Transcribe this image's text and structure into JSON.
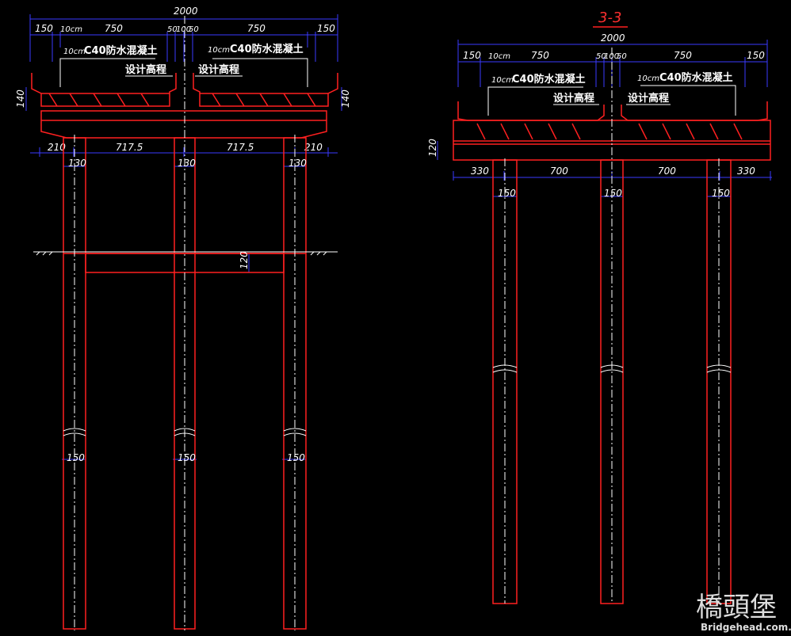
{
  "left_view": {
    "dims_top": {
      "total": "2000",
      "seg": [
        "150",
        "10cm",
        "750",
        "50",
        "100",
        "50",
        "750",
        "150"
      ]
    },
    "notes": {
      "concrete_left": "C40防水混凝土",
      "concrete_left_prefix": "10cm",
      "concrete_right": "C40防水混凝土",
      "concrete_right_prefix": "10cm",
      "elev_left": "设计高程",
      "elev_right": "设计高程"
    },
    "dims_side": {
      "left": "140",
      "right": "140"
    },
    "dims_cap": [
      "210",
      "717.5",
      "717.5",
      "210"
    ],
    "dims_pile_top": [
      "130",
      "130",
      "130"
    ],
    "dims_tie": "120",
    "dims_pile_bottom": [
      "150",
      "150",
      "150"
    ]
  },
  "right_view": {
    "title": "3-3",
    "dims_top": {
      "total": "2000",
      "seg": [
        "150",
        "10cm",
        "750",
        "50",
        "100",
        "50",
        "750",
        "150"
      ]
    },
    "notes": {
      "concrete_left": "C40防水混凝土",
      "concrete_left_prefix": "10cm",
      "concrete_right": "C40防水混凝土",
      "concrete_right_prefix": "10cm",
      "elev_left": "设计高程",
      "elev_right": "设计高程"
    },
    "dims_side": "120",
    "dims_cap": [
      "330",
      "700",
      "700",
      "330"
    ],
    "dims_pile": [
      "150",
      "150",
      "150"
    ]
  },
  "watermark": {
    "logo": "橋頭堡",
    "url": "Bridgehead.com.cn"
  },
  "colors": {
    "structure": "#ff2020",
    "dimension": "#3a3aff",
    "text": "#ffffff",
    "background": "#000000",
    "axis": "#ffffff"
  }
}
